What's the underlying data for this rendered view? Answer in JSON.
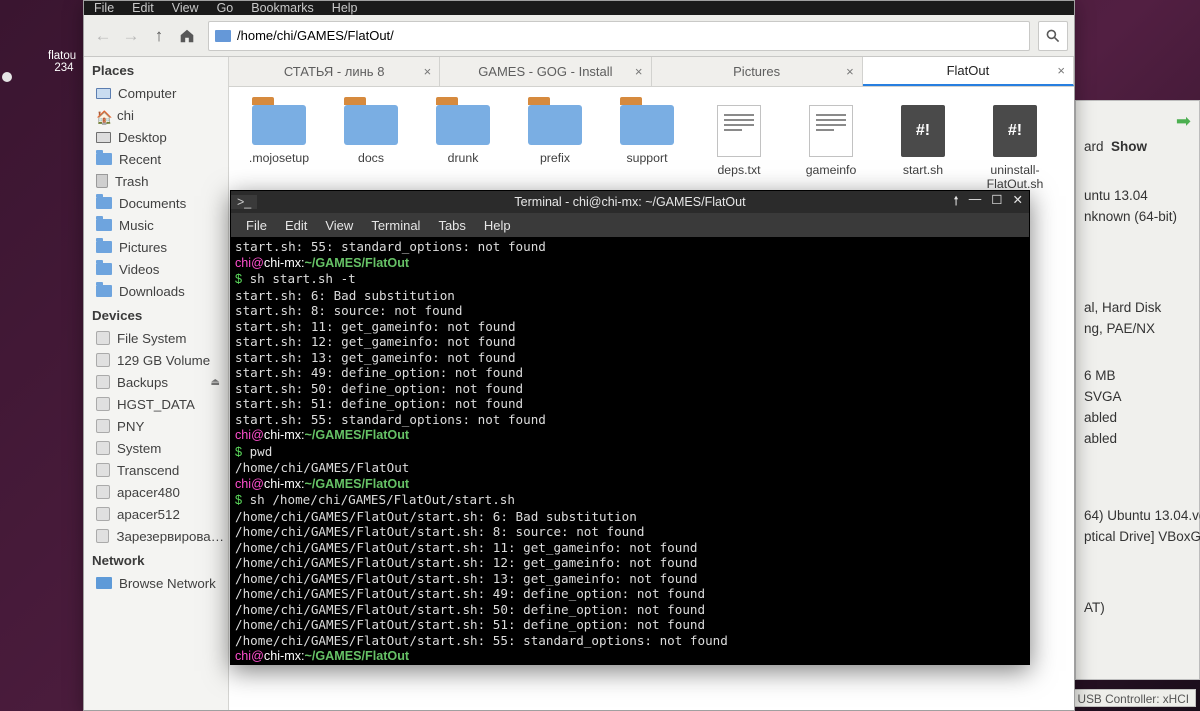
{
  "desktop": {
    "dock_label_line1": "flatou",
    "dock_label_line2": "234"
  },
  "background_vbox": {
    "forward": "ard",
    "show": "Show",
    "os_line1": "untu 13.04",
    "os_line2": "nknown (64-bit)",
    "sys1": "al, Hard Disk",
    "sys2": "ng, PAE/NX",
    "disp1": "6 MB",
    "disp2": "SVGA",
    "disp3": "abled",
    "disp4": "abled",
    "stor1": "64) Ubuntu 13.04.vd",
    "stor2": "ptical Drive] VBoxG",
    "stor3": "AT)",
    "status": "USB Controller:  xHCI"
  },
  "fm": {
    "menubar": [
      "File",
      "Edit",
      "View",
      "Go",
      "Bookmarks",
      "Help"
    ],
    "path": "/home/chi/GAMES/FlatOut/",
    "sidebar": {
      "places_hdr": "Places",
      "places": [
        "Computer",
        "chi",
        "Desktop",
        "Recent",
        "Trash",
        "Documents",
        "Music",
        "Pictures",
        "Videos",
        "Downloads"
      ],
      "devices_hdr": "Devices",
      "devices": [
        "File System",
        "129 GB Volume",
        "Backups",
        "HGST_DATA",
        "PNY",
        "System",
        "Transcend",
        "apacer480",
        "apacer512",
        "Зарезервирова…"
      ],
      "network_hdr": "Network",
      "network": [
        "Browse Network"
      ],
      "eject_on": "Backups"
    },
    "tabs": [
      {
        "label": "СТАТЬЯ - линь 8",
        "active": false
      },
      {
        "label": "GAMES - GOG - Install",
        "active": false
      },
      {
        "label": "Pictures",
        "active": false
      },
      {
        "label": "FlatOut",
        "active": true
      }
    ],
    "files": [
      {
        "name": ".mojosetup",
        "type": "folder"
      },
      {
        "name": "docs",
        "type": "folder"
      },
      {
        "name": "drunk",
        "type": "folder"
      },
      {
        "name": "prefix",
        "type": "folder"
      },
      {
        "name": "support",
        "type": "folder"
      },
      {
        "name": "deps.txt",
        "type": "txt"
      },
      {
        "name": "gameinfo",
        "type": "txt"
      },
      {
        "name": "start.sh",
        "type": "sh"
      },
      {
        "name": "uninstall-FlatOut.sh",
        "type": "sh"
      }
    ]
  },
  "terminal": {
    "title": "Terminal - chi@chi-mx: ~/GAMES/FlatOut",
    "menubar": [
      "File",
      "Edit",
      "View",
      "Terminal",
      "Tabs",
      "Help"
    ],
    "prompt": {
      "user": "chi",
      "host": "chi-mx",
      "path": "~/GAMES/FlatOut"
    },
    "lines": [
      {
        "t": "out",
        "s": "start.sh: 55: standard_options: not found"
      },
      {
        "t": "prompt"
      },
      {
        "t": "cmd",
        "s": "sh start.sh -t"
      },
      {
        "t": "out",
        "s": "start.sh: 6: Bad substitution"
      },
      {
        "t": "out",
        "s": "start.sh: 8: source: not found"
      },
      {
        "t": "out",
        "s": "start.sh: 11: get_gameinfo: not found"
      },
      {
        "t": "out",
        "s": "start.sh: 12: get_gameinfo: not found"
      },
      {
        "t": "out",
        "s": "start.sh: 13: get_gameinfo: not found"
      },
      {
        "t": "out",
        "s": "start.sh: 49: define_option: not found"
      },
      {
        "t": "out",
        "s": "start.sh: 50: define_option: not found"
      },
      {
        "t": "out",
        "s": "start.sh: 51: define_option: not found"
      },
      {
        "t": "out",
        "s": "start.sh: 55: standard_options: not found"
      },
      {
        "t": "prompt"
      },
      {
        "t": "cmd",
        "s": "pwd"
      },
      {
        "t": "out",
        "s": "/home/chi/GAMES/FlatOut"
      },
      {
        "t": "prompt"
      },
      {
        "t": "cmd",
        "s": "sh /home/chi/GAMES/FlatOut/start.sh"
      },
      {
        "t": "out",
        "s": "/home/chi/GAMES/FlatOut/start.sh: 6: Bad substitution"
      },
      {
        "t": "out",
        "s": "/home/chi/GAMES/FlatOut/start.sh: 8: source: not found"
      },
      {
        "t": "out",
        "s": "/home/chi/GAMES/FlatOut/start.sh: 11: get_gameinfo: not found"
      },
      {
        "t": "out",
        "s": "/home/chi/GAMES/FlatOut/start.sh: 12: get_gameinfo: not found"
      },
      {
        "t": "out",
        "s": "/home/chi/GAMES/FlatOut/start.sh: 13: get_gameinfo: not found"
      },
      {
        "t": "out",
        "s": "/home/chi/GAMES/FlatOut/start.sh: 49: define_option: not found"
      },
      {
        "t": "out",
        "s": "/home/chi/GAMES/FlatOut/start.sh: 50: define_option: not found"
      },
      {
        "t": "out",
        "s": "/home/chi/GAMES/FlatOut/start.sh: 51: define_option: not found"
      },
      {
        "t": "out",
        "s": "/home/chi/GAMES/FlatOut/start.sh: 55: standard_options: not found"
      },
      {
        "t": "prompt"
      },
      {
        "t": "cursor"
      }
    ]
  }
}
